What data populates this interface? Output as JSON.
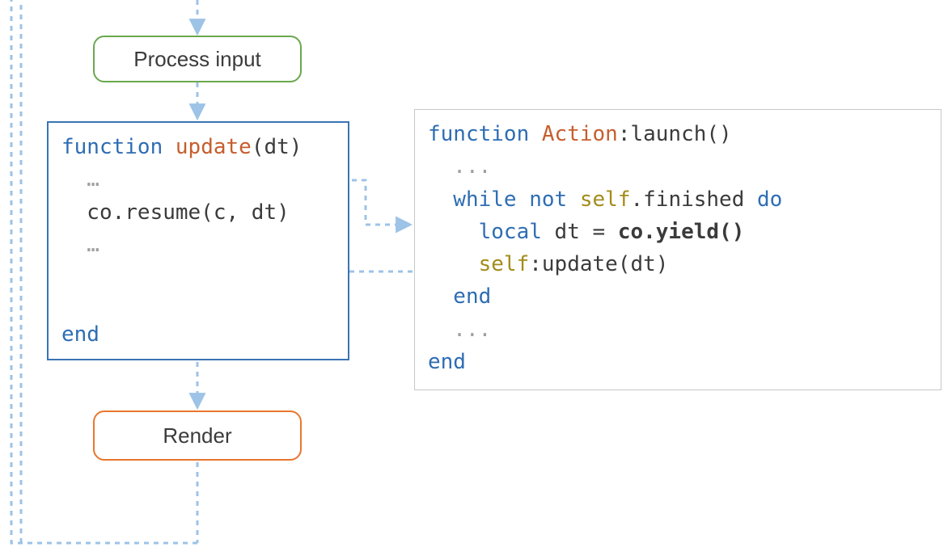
{
  "colors": {
    "keyword": "#2e6db3",
    "func_accent": "#c65e2d",
    "self_accent": "#a38c1a",
    "dim": "#9e9e9e",
    "box_blue": "#3a74b6",
    "box_gray": "#c8c8c8",
    "node_green": "#6aa84f",
    "node_orange": "#e8762d",
    "arrow": "#9dc3e6"
  },
  "nodes": {
    "process_input": {
      "label": "Process input"
    },
    "render": {
      "label": "Render"
    }
  },
  "update_box": {
    "l1_kw": "function ",
    "l1_fn": "update",
    "l1_rest": "(dt)",
    "l2_dim": "  …",
    "l3": "  co.resume(c, dt)",
    "l4_dim": "  …",
    "l5_kw": "end"
  },
  "launch_box": {
    "l1_kw1": "function ",
    "l1_fn": "Action",
    "l1_rest": ":launch()",
    "l2_dim": "  ...",
    "l3_kw1": "  while ",
    "l3_kw2": "not ",
    "l3_self": "self",
    "l3_rest": ".finished ",
    "l3_kw3": "do",
    "l4_kw": "    local",
    "l4_rest1": " dt = ",
    "l4_bold": "co.yield()",
    "l5_self": "    self",
    "l5_rest": ":update(dt)",
    "l6_kw": "  end",
    "l7_dim": "  ...",
    "l8_kw": "end"
  }
}
